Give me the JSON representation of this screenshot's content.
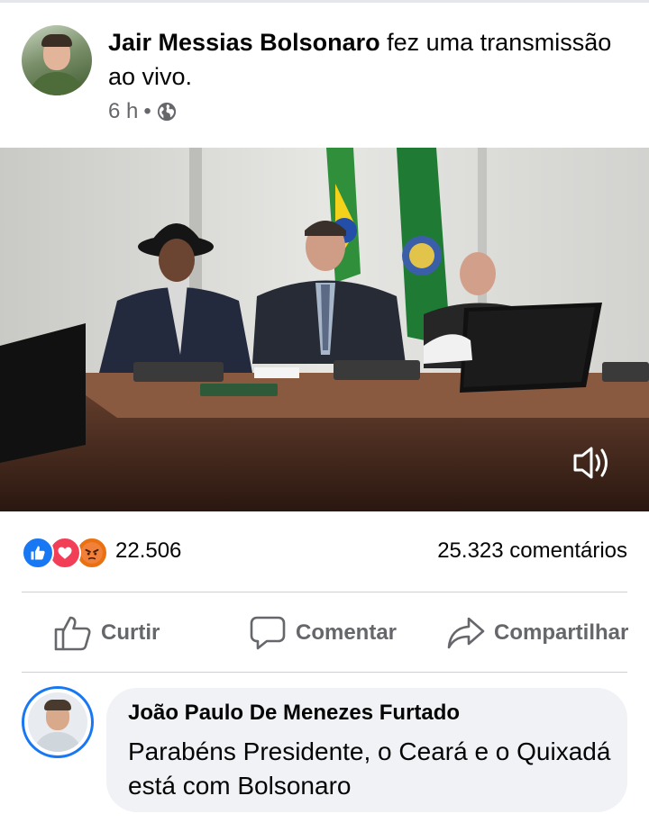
{
  "post": {
    "author": "Jair Messias Bolsonaro",
    "action_text": " fez uma transmissão ao vivo.",
    "time": "6 h",
    "separator": "•",
    "privacy_icon": "globe-icon"
  },
  "video": {
    "sound_icon": "volume-icon"
  },
  "reactions": {
    "icons": [
      "like-icon",
      "love-icon",
      "angry-icon"
    ],
    "count": "22.506",
    "comments": "25.323 comentários"
  },
  "actions": {
    "like_label": "Curtir",
    "comment_label": "Comentar",
    "share_label": "Compartilhar"
  },
  "comment": {
    "author": "João Paulo De Menezes Furtado",
    "text": "Parabéns Presidente, o Ceará e o Quixadá está com Bolsonaro"
  },
  "colors": {
    "accent": "#1877f2",
    "muted_text": "#65676b",
    "bubble_bg": "#f0f2f5",
    "love": "#f33e58",
    "angry": "#e9710f"
  }
}
